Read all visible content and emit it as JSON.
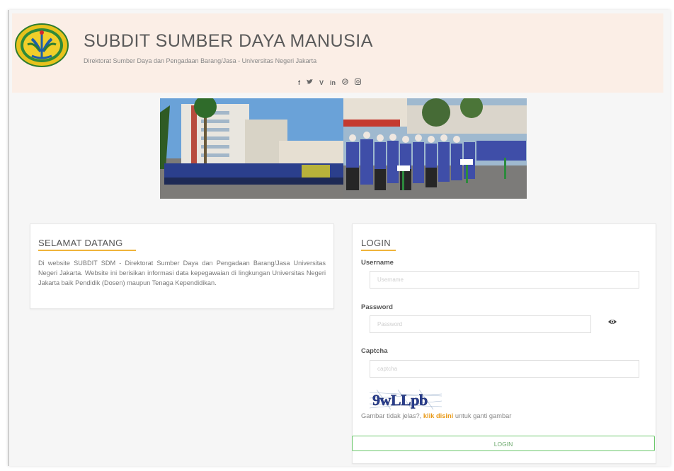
{
  "header": {
    "title": "SUBDIT SUMBER DAYA MANUSIA",
    "subtitle": "Direktorat Sumber Daya dan Pengadaan Barang/Jasa - Universitas Negeri Jakarta",
    "social_icons": [
      "facebook-icon",
      "twitter-icon",
      "vimeo-icon",
      "linkedin-icon",
      "dribbble-icon",
      "instagram-icon"
    ]
  },
  "welcome": {
    "title": "SELAMAT DATANG",
    "text": "Di website SUBDIT SDM - Direktorat Sumber Daya dan Pengadaan Barang/Jasa Universitas Negeri Jakarta. Website ini berisikan informasi data kepegawaian di lingkungan Universitas Negeri Jakarta baik Pendidik (Dosen) maupun Tenaga Kependidikan."
  },
  "login": {
    "title": "LOGIN",
    "username_label": "Username",
    "username_placeholder": "Username",
    "password_label": "Password",
    "password_placeholder": "Password",
    "captcha_label": "Captcha",
    "captcha_placeholder": "captcha",
    "captcha_code": "9wLLpb",
    "captcha_help_prefix": "Gambar tidak jelas?, ",
    "captcha_help_link": "klik disini",
    "captcha_help_suffix": " untuk ganti gambar",
    "button_label": "LOGIN"
  },
  "colors": {
    "header_bg": "#fbeee6",
    "accent": "#f0b43a",
    "link": "#e89a1a",
    "button_border": "#6cc86c"
  }
}
